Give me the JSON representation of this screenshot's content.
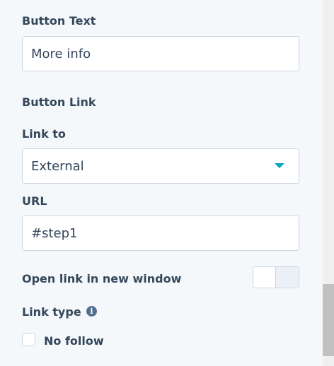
{
  "button_text": {
    "label": "Button Text",
    "value": "More info"
  },
  "button_link": {
    "section_label": "Button Link"
  },
  "link_to": {
    "label": "Link to",
    "selected": "External",
    "arrow_icon": "caret-down-icon",
    "accent_color": "#00a4bd"
  },
  "url": {
    "label": "URL",
    "value": "#step1"
  },
  "open_new_window": {
    "label": "Open link in new window",
    "enabled": false
  },
  "link_type": {
    "label": "Link type",
    "info_icon": "info-icon",
    "info_glyph": "i"
  },
  "no_follow": {
    "label": "No follow",
    "checked": false
  }
}
